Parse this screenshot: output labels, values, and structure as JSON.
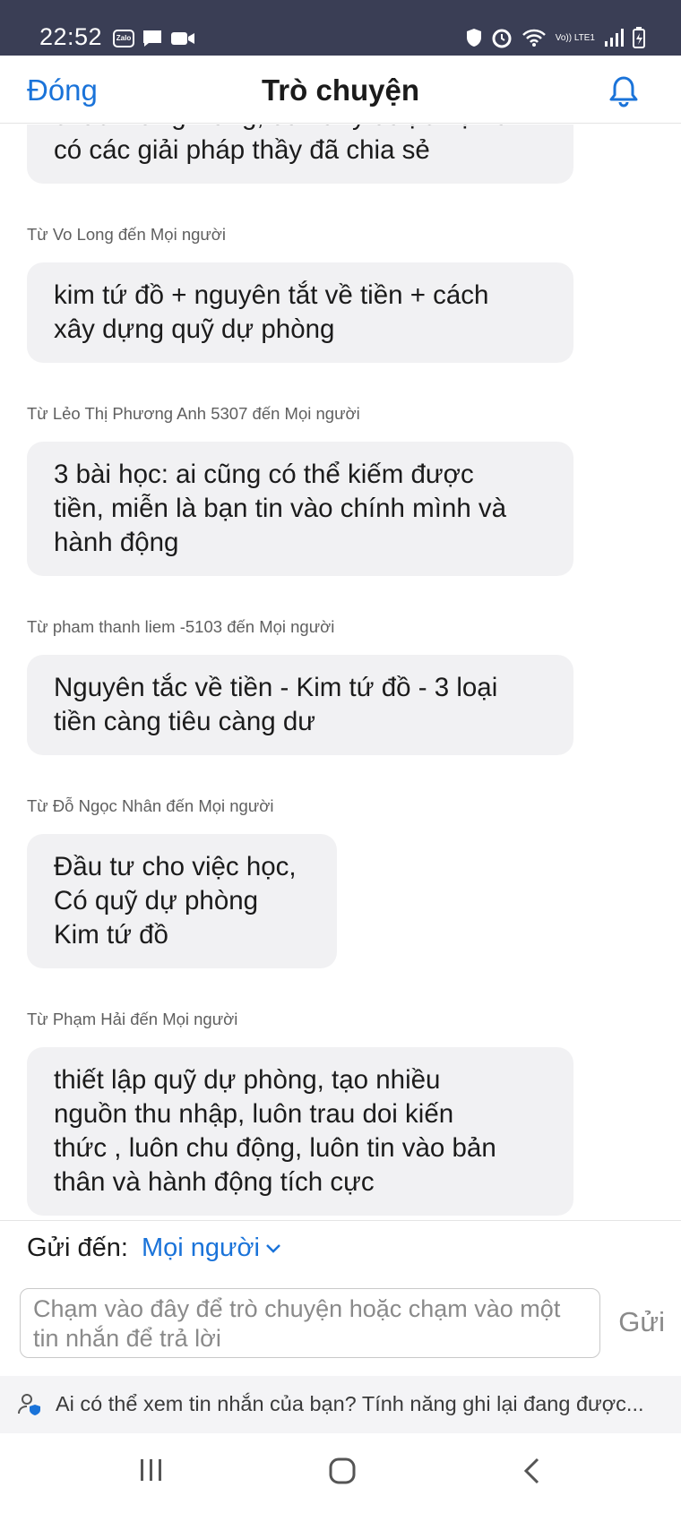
{
  "status_bar": {
    "time": "22:52",
    "app_badge": "Zalo",
    "lte_label": "Vo)) LTE1"
  },
  "header": {
    "close_label": "Đóng",
    "title": "Trò chuyện"
  },
  "messages": [
    {
      "sender": "",
      "text": "chúc mừng Hằng, đã xử lý được nợ và\ncó các giải pháp thầy đã chia sẻ"
    },
    {
      "sender": "Từ Vo Long đến Mọi người",
      "text": "kim tứ đồ + nguyên tắt về tiền + cách\nxây dựng quỹ dự phòng"
    },
    {
      "sender": "Từ Lẻo Thị Phương Anh 5307 đến Mọi người",
      "text": "3 bài học: ai cũng có thể kiếm được\ntiền, miễn là bạn tin vào chính mình và\nhành động"
    },
    {
      "sender": "Từ pham thanh liem -5103 đến Mọi người",
      "text": "Nguyên tắc về tiền - Kim tứ đồ - 3 loại\ntiền càng tiêu càng dư"
    },
    {
      "sender": "Từ Đỗ Ngọc Nhân đến Mọi người",
      "text": "Đầu tư cho việc học,\nCó quỹ dự phòng\nKim tứ đồ"
    },
    {
      "sender": "Từ Phạm Hải đến Mọi người",
      "text": "thiết lập quỹ dự phòng, tạo nhiều\nnguồn thu nhập,  luôn trau doi kiến\nthức ,  luôn chu động, luôn tin vào bản\nthân và hành động tích cực"
    }
  ],
  "composer": {
    "send_to_label": "Gửi đến:",
    "send_to_value": "Mọi người",
    "placeholder": "Chạm vào đây để trò chuyện hoặc chạm vào một tin nhắn để trả lời",
    "send_label": "Gửi"
  },
  "notice": {
    "text": "Ai có thể xem tin nhắn của bạn? Tính năng ghi lại đang được..."
  },
  "colors": {
    "accent": "#1a73d9",
    "status_bar": "#3a3e55",
    "bubble": "#f1f1f3"
  }
}
